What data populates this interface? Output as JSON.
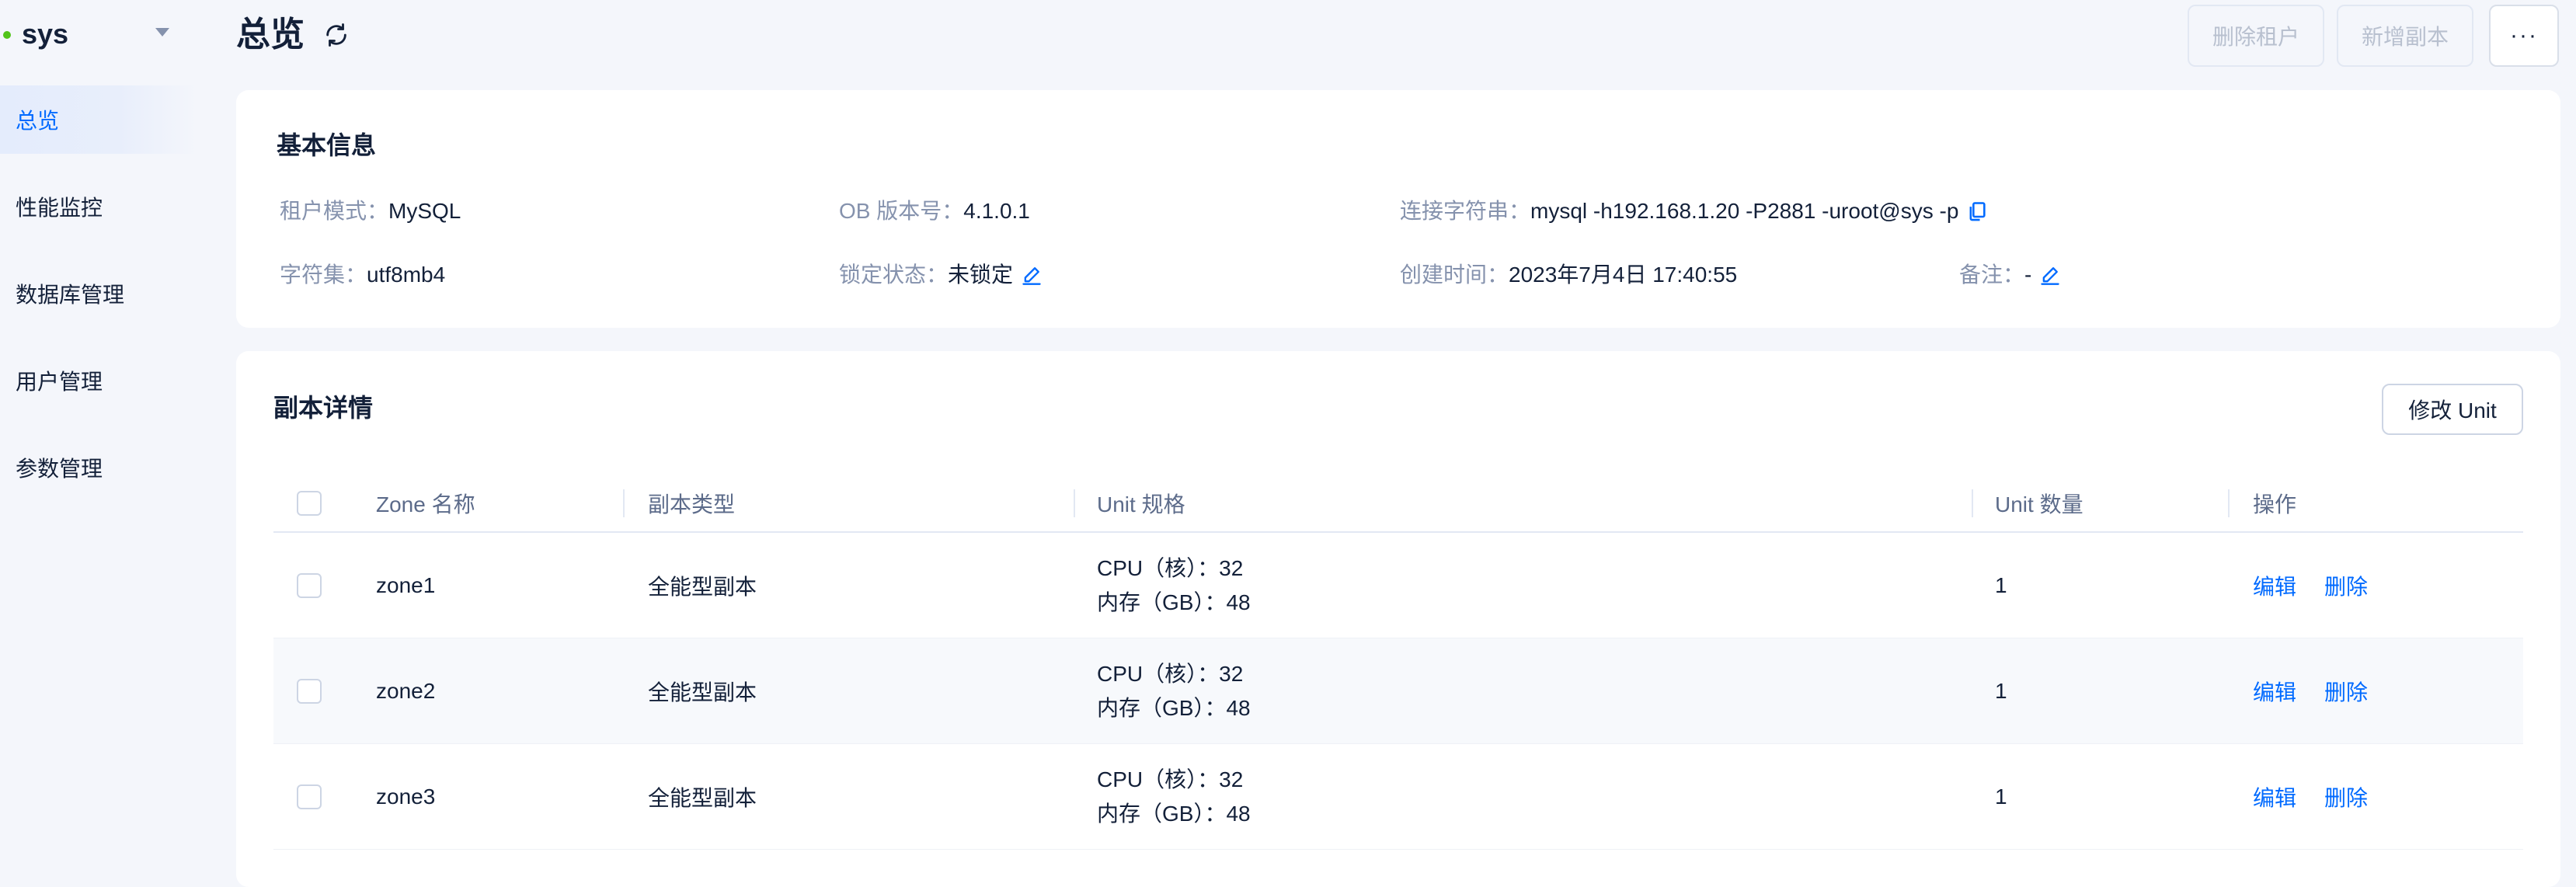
{
  "sidebar": {
    "tenant": "sys",
    "items": [
      {
        "label": "总览",
        "active": true
      },
      {
        "label": "性能监控",
        "active": false
      },
      {
        "label": "数据库管理",
        "active": false
      },
      {
        "label": "用户管理",
        "active": false
      },
      {
        "label": "参数管理",
        "active": false
      }
    ]
  },
  "header": {
    "title": "总览",
    "delete_tenant_label": "删除租户",
    "add_replica_label": "新增副本",
    "more_label": "···"
  },
  "basic_info": {
    "title": "基本信息",
    "tenant_mode_label": "租户模式：",
    "tenant_mode": "MySQL",
    "ob_version_label": "OB 版本号：",
    "ob_version": "4.1.0.1",
    "conn_string_label": "连接字符串：",
    "conn_string": "mysql -h192.168.1.20 -P2881 -uroot@sys -p",
    "charset_label": "字符集：",
    "charset": "utf8mb4",
    "lock_status_label": "锁定状态：",
    "lock_status": "未锁定",
    "created_label": "创建时间：",
    "created": "2023年7月4日 17:40:55",
    "remark_label": "备注：",
    "remark": "-"
  },
  "replica": {
    "title": "副本详情",
    "modify_unit_label": "修改 Unit",
    "columns": [
      "Zone 名称",
      "副本类型",
      "Unit 规格",
      "Unit 数量",
      "操作"
    ],
    "rows": [
      {
        "zone": "zone1",
        "type": "全能型副本",
        "cpu": "CPU（核）：32",
        "mem": "内存（GB）：48",
        "count": "1",
        "edit": "编辑",
        "delete": "删除"
      },
      {
        "zone": "zone2",
        "type": "全能型副本",
        "cpu": "CPU（核）：32",
        "mem": "内存（GB）：48",
        "count": "1",
        "edit": "编辑",
        "delete": "删除"
      },
      {
        "zone": "zone3",
        "type": "全能型副本",
        "cpu": "CPU（核）：32",
        "mem": "内存（GB）：48",
        "count": "1",
        "edit": "编辑",
        "delete": "删除"
      }
    ]
  },
  "colors": {
    "accent": "#006aff",
    "status_dot": "#52c41a",
    "label": "#8592ad",
    "text": "#132039"
  },
  "icons": {
    "refresh": "refresh-icon",
    "edit": "edit-icon",
    "copy": "copy-icon",
    "caret": "caret-down-icon"
  }
}
